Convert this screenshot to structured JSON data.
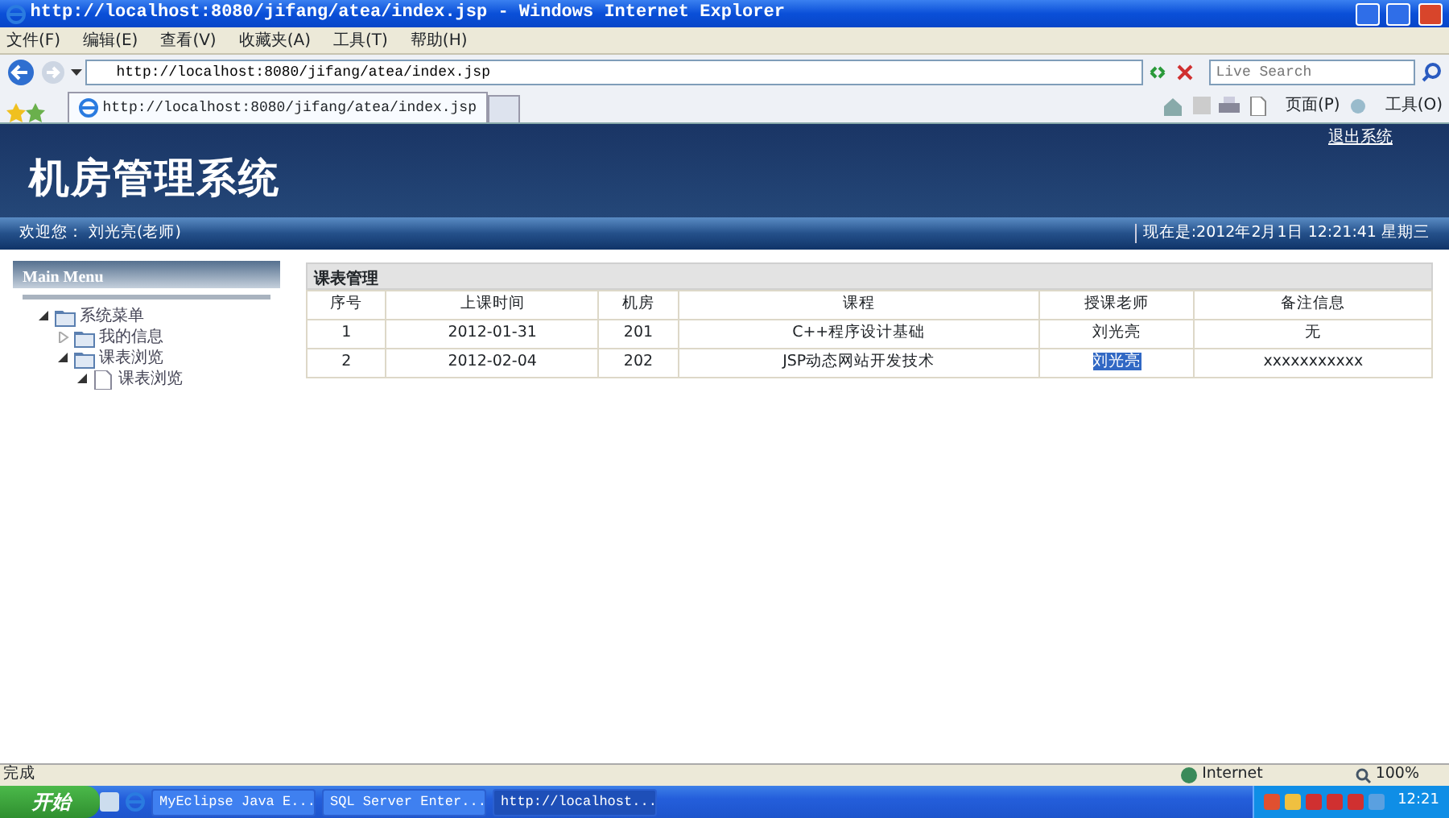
{
  "window": {
    "title": "http://localhost:8080/jifang/atea/index.jsp - Windows Internet Explorer"
  },
  "menu": [
    "文件(F)",
    "编辑(E)",
    "查看(V)",
    "收藏夹(A)",
    "工具(T)",
    "帮助(H)"
  ],
  "address": {
    "value": "http://localhost:8080/jifang/atea/index.jsp"
  },
  "search": {
    "placeholder": "Live Search"
  },
  "browser_tab": {
    "title": "http://localhost:8080/jifang/atea/index.jsp"
  },
  "command_bar": [
    "页面(P)",
    "工具(O)"
  ],
  "header": {
    "title": "机房管理系统",
    "logout": "退出系统"
  },
  "info_bar": {
    "welcome": "欢迎您： 刘光亮(老师)",
    "clock": "现在是:2012年2月1日  12:21:41 星期三"
  },
  "sidebar": {
    "title": "Main Menu",
    "tree": [
      {
        "label": "系统菜单",
        "kind": "folder",
        "expanded": true,
        "children": [
          {
            "label": "我的信息",
            "kind": "folder",
            "expanded": false
          },
          {
            "label": "课表浏览",
            "kind": "folder",
            "expanded": true,
            "children": [
              {
                "label": "课表浏览",
                "kind": "page",
                "expanded": true
              }
            ]
          }
        ]
      }
    ]
  },
  "table": {
    "title": "课表管理",
    "columns": [
      "序号",
      "上课时间",
      "机房",
      "课程",
      "授课老师",
      "备注信息"
    ],
    "rows": [
      {
        "cells": [
          "1",
          "2012-01-31",
          "201",
          "C++程序设计基础",
          "刘光亮",
          "无"
        ],
        "highlighted": [
          false,
          false,
          false,
          false,
          false,
          false
        ]
      },
      {
        "cells": [
          "2",
          "2012-02-04",
          "202",
          "JSP动态网站开发技术",
          "刘光亮",
          "xxxxxxxxxxx"
        ],
        "highlighted": [
          false,
          false,
          false,
          false,
          true,
          false
        ]
      }
    ]
  },
  "status_bar": {
    "text": "完成",
    "zone": "Internet",
    "zoom": "100%"
  },
  "taskbar": {
    "start": "开始",
    "tasks": [
      {
        "label": "MyEclipse Java E...",
        "selected": false
      },
      {
        "label": "SQL Server Enter...",
        "selected": false
      },
      {
        "label": "http://localhost...",
        "selected": true
      }
    ],
    "clock": "12:21"
  }
}
